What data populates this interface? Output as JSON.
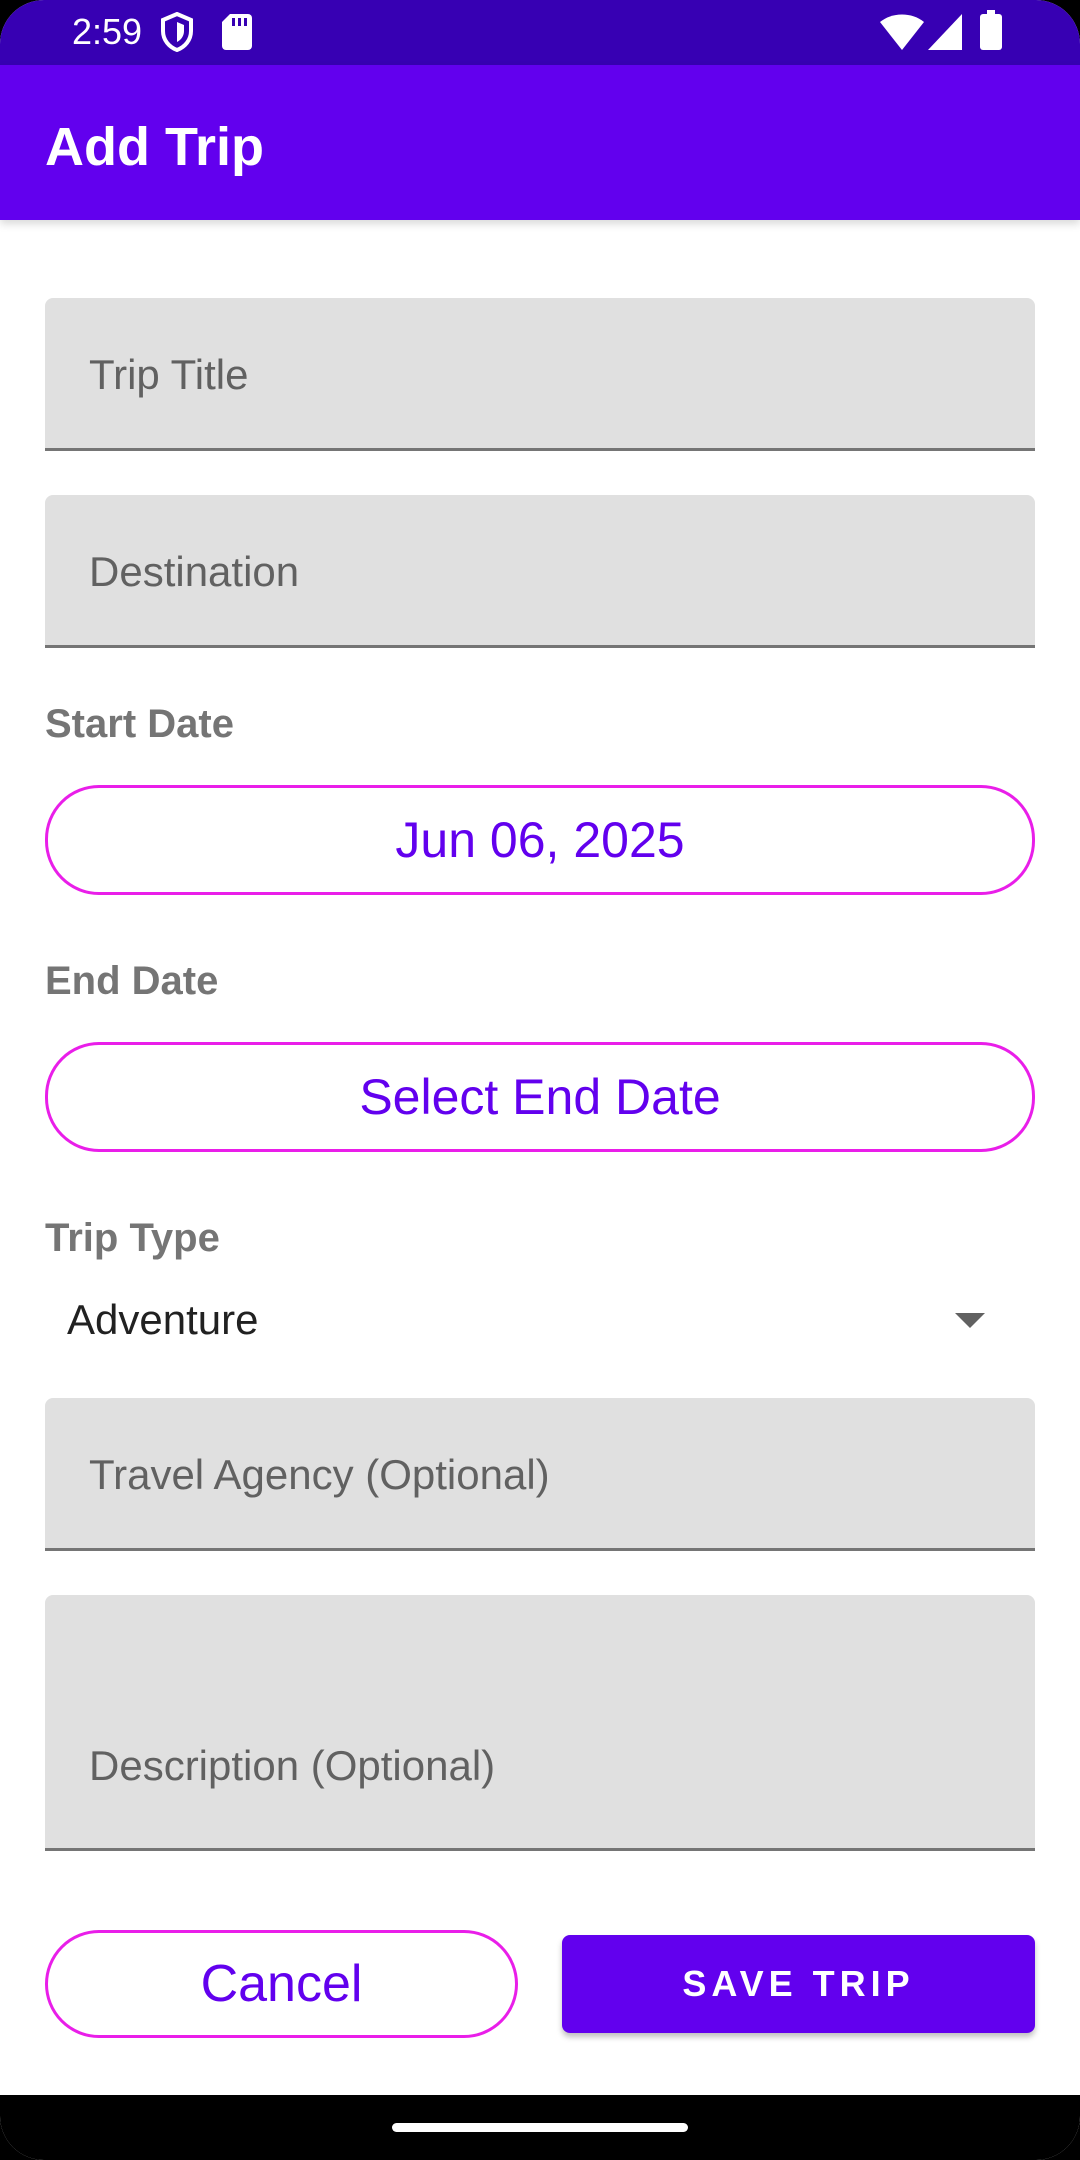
{
  "status_bar": {
    "time": "2:59",
    "icons": [
      "shield-icon",
      "sd-card-icon",
      "wifi-icon",
      "signal-icon",
      "battery-icon"
    ],
    "color": "#3700b3"
  },
  "app_bar": {
    "title": "Add Trip",
    "color": "#6200ee"
  },
  "form": {
    "trip_title_placeholder": "Trip Title",
    "destination_placeholder": "Destination",
    "start_date_label": "Start Date",
    "start_date_value": "Jun 06, 2025",
    "end_date_label": "End Date",
    "end_date_button": "Select End Date",
    "trip_type_label": "Trip Type",
    "trip_type_value": "Adventure",
    "agency_placeholder": "Travel Agency (Optional)",
    "description_placeholder": "Description (Optional)"
  },
  "actions": {
    "cancel_label": "Cancel",
    "save_label": "SAVE TRIP"
  },
  "colors": {
    "accent": "#6200ee",
    "outline": "#e91ee9",
    "field_bg": "#e0e0e0"
  }
}
